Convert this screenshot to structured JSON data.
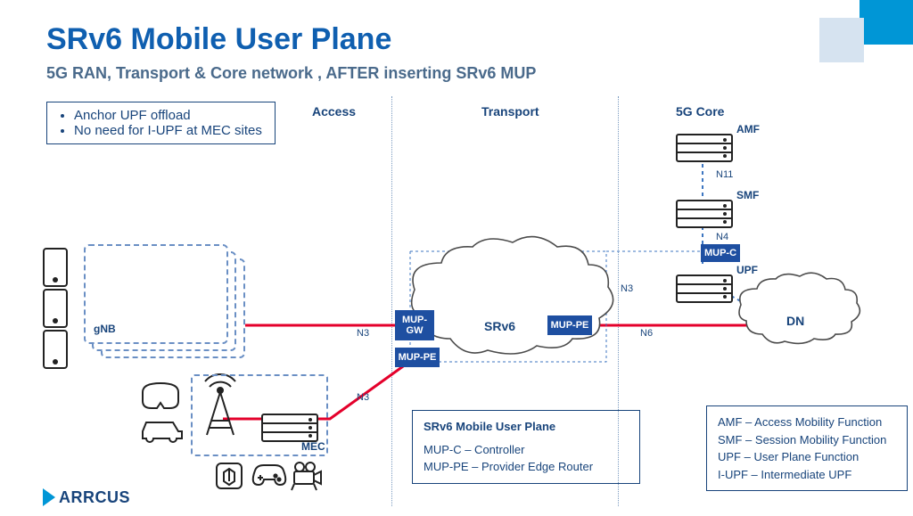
{
  "title": "SRv6 Mobile User Plane",
  "subtitle": "5G RAN, Transport & Core network , AFTER inserting SRv6 MUP",
  "notes": {
    "item1": "Anchor UPF offload",
    "item2": "No need for I-UPF at MEC sites"
  },
  "zones": {
    "access": "Access",
    "transport": "Transport",
    "core": "5G Core"
  },
  "nodes": {
    "gnb": "gNB",
    "mec": "MEC",
    "mup_gw": "MUP-GW",
    "mup_pe1": "MUP-PE",
    "mup_pe2": "MUP-PE",
    "mup_c": "MUP-C",
    "srv6": "SRv6",
    "amf": "AMF",
    "smf": "SMF",
    "upf": "UPF",
    "dn": "DN"
  },
  "iface": {
    "n3a": "N3",
    "n3b": "N3",
    "n3c": "N3",
    "n4": "N4",
    "n6": "N6",
    "n11": "N11"
  },
  "legend_srv6": {
    "title": "SRv6 Mobile User Plane",
    "l1": "MUP-C  – Controller",
    "l2": "MUP-PE – Provider Edge Router"
  },
  "legend_nf": {
    "l1": "AMF  – Access Mobility Function",
    "l2": "SMF  – Session Mobility Function",
    "l3": "UPF   – User Plane Function",
    "l4": "I-UPF – Intermediate UPF"
  },
  "brand": "ARRCUS"
}
